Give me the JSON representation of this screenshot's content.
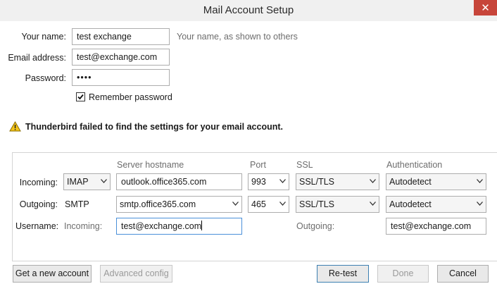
{
  "window": {
    "title": "Mail Account Setup",
    "close_glyph": "✕"
  },
  "form": {
    "name_label": "Your name:",
    "name_value": "test exchange",
    "name_hint": "Your name, as shown to others",
    "email_label": "Email address:",
    "email_value": "test@exchange.com",
    "password_label": "Password:",
    "password_value": "••••",
    "remember_label": "Remember password",
    "remember_checked": true
  },
  "warning": {
    "icon": "warning-icon",
    "text": "Thunderbird failed to find the settings for your email account."
  },
  "server_table": {
    "headers": {
      "hostname": "Server hostname",
      "port": "Port",
      "ssl": "SSL",
      "auth": "Authentication"
    },
    "incoming": {
      "label": "Incoming:",
      "protocol": "IMAP",
      "hostname": "outlook.office365.com",
      "port": "993",
      "ssl": "SSL/TLS",
      "auth": "Autodetect"
    },
    "outgoing": {
      "label": "Outgoing:",
      "protocol": "SMTP",
      "hostname": "smtp.office365.com",
      "port": "465",
      "ssl": "SSL/TLS",
      "auth": "Autodetect"
    },
    "username": {
      "label": "Username:",
      "incoming_label": "Incoming:",
      "incoming_value": "test@exchange.com",
      "outgoing_label": "Outgoing:",
      "outgoing_value": "test@exchange.com"
    }
  },
  "buttons": {
    "new_account": "Get a new account",
    "advanced": "Advanced config",
    "retest": "Re-test",
    "done": "Done",
    "cancel": "Cancel"
  },
  "colors": {
    "close_bg": "#c7453a",
    "focus_border": "#4a90d9",
    "warning_fill": "#f5c518"
  }
}
